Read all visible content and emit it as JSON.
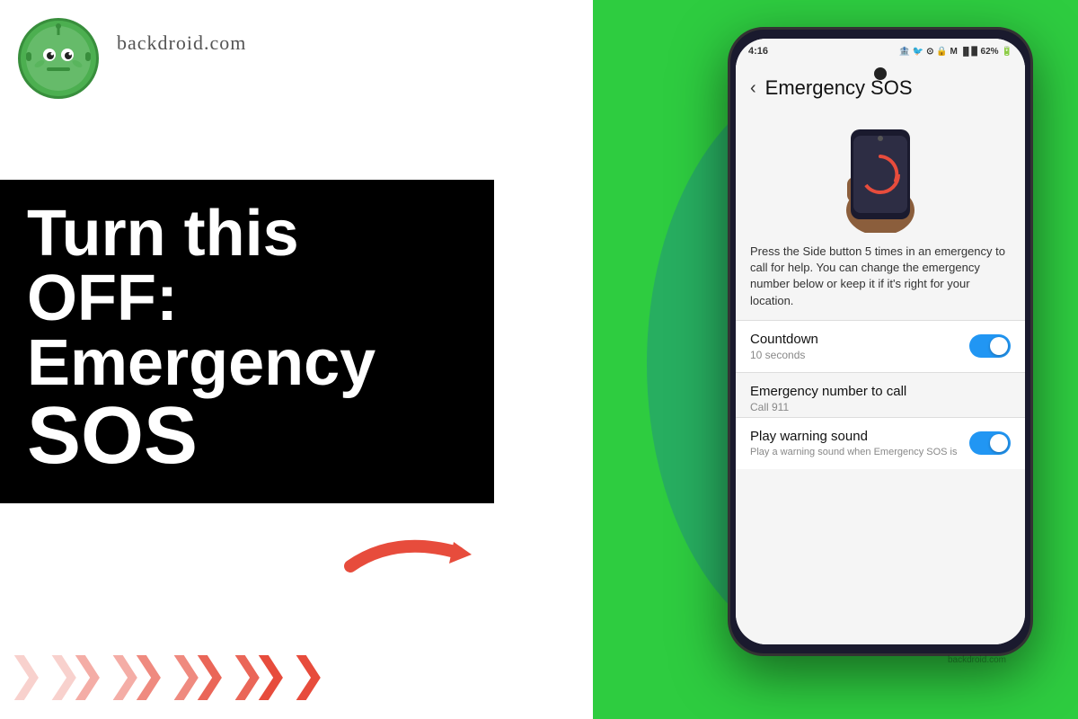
{
  "site": {
    "domain": "backdroid.com"
  },
  "headline": {
    "line1": "Turn this OFF:",
    "line2": "Emergency",
    "line3": "SOS"
  },
  "phone": {
    "status_bar": {
      "time": "4:16",
      "icons": "🏦 🐦 ⚙ 🔒 M",
      "battery": "62%"
    },
    "screen_title": "Emergency SOS",
    "back_icon": "‹",
    "description": "Press the Side button 5 times in an emergency to call for help. You can change the emergency number below or keep it if it's right for your location.",
    "settings": [
      {
        "label": "Countdown",
        "sub": "10 seconds",
        "toggle": true,
        "toggle_on": true
      },
      {
        "label": "Emergency number to call",
        "sub": "Call 911",
        "toggle": false
      },
      {
        "label": "Play warning sound",
        "sub": "Play a warning sound when Emergency SOS is",
        "toggle": true,
        "toggle_on": true
      }
    ]
  },
  "arrow": {
    "color": "#e74c3c",
    "symbol": "➜"
  },
  "chevrons": [
    {
      "opacity": 0.3
    },
    {
      "opacity": 0.45
    },
    {
      "opacity": 0.6
    },
    {
      "opacity": 0.75
    },
    {
      "opacity": 1.0
    }
  ]
}
